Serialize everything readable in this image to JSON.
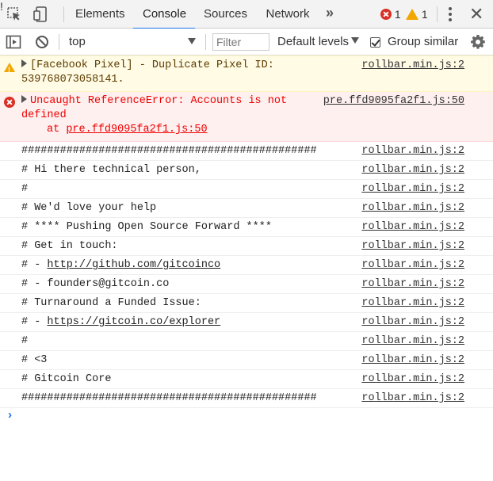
{
  "tabs": {
    "elements": "Elements",
    "console": "Console",
    "sources": "Sources",
    "network": "Network",
    "more": "»"
  },
  "counts": {
    "errors": "1",
    "warnings": "1"
  },
  "toolbar": {
    "context": "top",
    "filter_placeholder": "Filter",
    "levels": "Default levels",
    "group_similar": "Group similar"
  },
  "messages": {
    "warn": {
      "text": "[Facebook Pixel] - Duplicate Pixel ID:\n539768073058141.",
      "source": "rollbar.min.js:2"
    },
    "error": {
      "text": "Uncaught ReferenceError: Accounts is not\ndefined",
      "source": "pre.ffd9095fa2f1.js:50",
      "trace_prefix": "at ",
      "trace_link": "pre.ffd9095fa2f1.js:50"
    },
    "logs": [
      {
        "pre": "##############################################",
        "link": "",
        "post": "",
        "source": "rollbar.min.js:2"
      },
      {
        "pre": "# Hi there technical person,",
        "link": "",
        "post": "",
        "source": "rollbar.min.js:2"
      },
      {
        "pre": "#",
        "link": "",
        "post": "",
        "source": "rollbar.min.js:2"
      },
      {
        "pre": "# We'd love your help",
        "link": "",
        "post": "",
        "source": "rollbar.min.js:2"
      },
      {
        "pre": "# **** Pushing Open Source Forward ****",
        "link": "",
        "post": "",
        "source": "rollbar.min.js:2"
      },
      {
        "pre": "# Get in touch:",
        "link": "",
        "post": "",
        "source": "rollbar.min.js:2"
      },
      {
        "pre": "# - ",
        "link": "http://github.com/gitcoinco",
        "post": "",
        "source": "rollbar.min.js:2"
      },
      {
        "pre": "# - founders@gitcoin.co",
        "link": "",
        "post": "",
        "source": "rollbar.min.js:2"
      },
      {
        "pre": "# Turnaround a Funded Issue:",
        "link": "",
        "post": "",
        "source": "rollbar.min.js:2"
      },
      {
        "pre": "# - ",
        "link": "https://gitcoin.co/explorer",
        "post": "",
        "source": "rollbar.min.js:2"
      },
      {
        "pre": "#",
        "link": "",
        "post": "",
        "source": "rollbar.min.js:2"
      },
      {
        "pre": "# <3",
        "link": "",
        "post": "",
        "source": "rollbar.min.js:2"
      },
      {
        "pre": "# Gitcoin Core",
        "link": "",
        "post": "",
        "source": "rollbar.min.js:2"
      },
      {
        "pre": "##############################################",
        "link": "",
        "post": "",
        "source": "rollbar.min.js:2"
      }
    ]
  },
  "prompt": "›",
  "colors": {
    "accent": "#1a73e8",
    "error": "#d93025",
    "warning": "#f2a600"
  }
}
